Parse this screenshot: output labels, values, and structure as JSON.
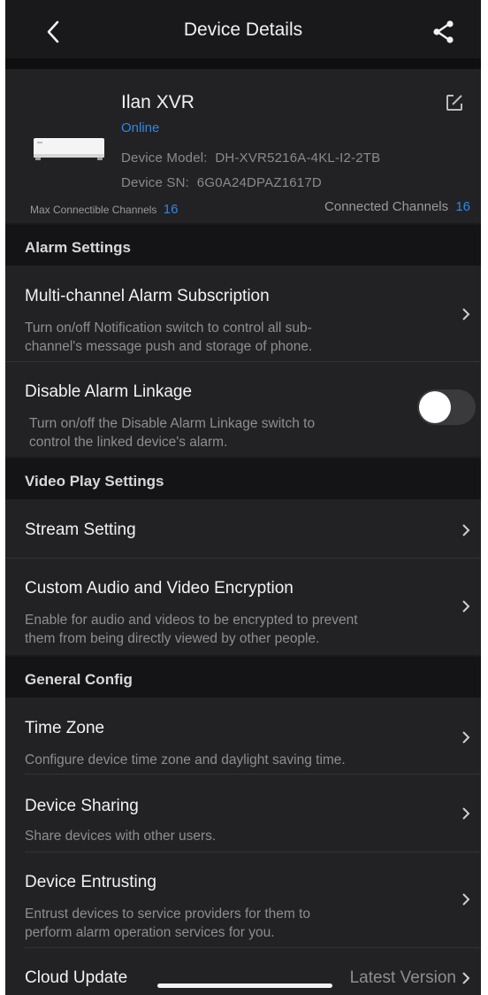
{
  "header": {
    "title": "Device Details",
    "back_icon": "chevron-left-icon",
    "share_icon": "share-icon"
  },
  "device": {
    "name": "Ilan XVR",
    "status": "Online",
    "model_label": "Device Model:",
    "model_value": "DH-XVR5216A-4KL-I2-2TB",
    "sn_label": "Device SN:",
    "sn_value": "6G0A24DPAZ1617D",
    "max_channels_label": "Max Connectible Channels",
    "max_channels_value": "16",
    "connected_channels_label": "Connected Channels",
    "connected_channels_value": "16",
    "status_color": "#2f86e6"
  },
  "alarm_settings": {
    "header": "Alarm Settings",
    "multi_channel": {
      "title": "Multi-channel Alarm Subscription",
      "desc_line1": "Turn on/off Notification switch to control all sub-",
      "desc_line2": "channel's message push and storage of phone."
    },
    "disable_linkage": {
      "title": "Disable Alarm Linkage",
      "desc_line1": "Turn on/off the Disable Alarm Linkage switch to",
      "desc_line2": "control the linked device's alarm.",
      "enabled": false
    }
  },
  "video_play_settings": {
    "header": "Video Play Settings",
    "stream": {
      "title": "Stream Setting"
    },
    "encryption": {
      "title": "Custom Audio and Video Encryption",
      "desc_line1": "Enable for audio and videos to be encrypted to prevent",
      "desc_line2": "them from being directly viewed by other people."
    }
  },
  "general_config": {
    "header": "General Config",
    "time_zone": {
      "title": "Time Zone",
      "desc": "Configure device time zone and daylight saving time."
    },
    "sharing": {
      "title": "Device Sharing",
      "desc": "Share devices with other users."
    },
    "entrusting": {
      "title": "Device Entrusting",
      "desc_line1": "Entrust devices to service providers for them to",
      "desc_line2": "perform alarm operation services for you."
    },
    "cloud_update": {
      "title": "Cloud Update",
      "value": "Latest Version"
    }
  }
}
